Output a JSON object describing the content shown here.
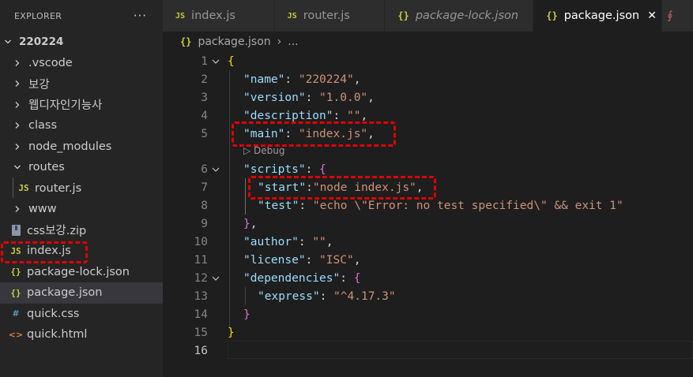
{
  "explorer": {
    "title": "EXPLORER",
    "more": "···",
    "root": "220224",
    "items": [
      {
        "label": ".vscode",
        "type": "folder"
      },
      {
        "label": "보강",
        "type": "folder"
      },
      {
        "label": "웹디자인기능사",
        "type": "folder"
      },
      {
        "label": "class",
        "type": "folder"
      },
      {
        "label": "node_modules",
        "type": "folder"
      },
      {
        "label": "routes",
        "type": "folder-open"
      },
      {
        "label": "router.js",
        "type": "js"
      },
      {
        "label": "www",
        "type": "folder"
      },
      {
        "label": "css보강.zip",
        "type": "zip"
      },
      {
        "label": "index.js",
        "type": "js"
      },
      {
        "label": "package-lock.json",
        "type": "json"
      },
      {
        "label": "package.json",
        "type": "json"
      },
      {
        "label": "quick.css",
        "type": "css"
      },
      {
        "label": "quick.html",
        "type": "html"
      }
    ]
  },
  "tabs": [
    {
      "label": "index.js",
      "icon": "JS"
    },
    {
      "label": "router.js",
      "icon": "JS"
    },
    {
      "label": "package-lock.json",
      "icon": "{}"
    },
    {
      "label": "package.json",
      "icon": "{}",
      "close": "✕"
    }
  ],
  "breadcrumb": {
    "file": "package.json",
    "rest": "..."
  },
  "codelens": "▷ Debug",
  "editor": {
    "line_numbers": [
      "1",
      "2",
      "3",
      "4",
      "5",
      "6",
      "7",
      "8",
      "9",
      "10",
      "11",
      "12",
      "13",
      "14",
      "15",
      "16"
    ],
    "lines": {
      "l1_open": "{",
      "l2_key": "\"name\"",
      "l2_val": "\"220224\"",
      "l3_key": "\"version\"",
      "l3_val": "\"1.0.0\"",
      "l4_key": "\"description\"",
      "l4_val": "\"\"",
      "l5_key": "\"main\"",
      "l5_val": "\"index.js\"",
      "l6_key": "\"scripts\"",
      "l6_open": "{",
      "l7_key": "\"start\"",
      "l7_val": "\"node index.js\"",
      "l8_key": "\"test\"",
      "l8_val": "\"echo \\\"Error: no test specified\\\" && exit 1\"",
      "l9_close": "}",
      "l10_key": "\"author\"",
      "l10_val": "\"\"",
      "l11_key": "\"license\"",
      "l11_val": "\"ISC\"",
      "l12_key": "\"dependencies\"",
      "l12_open": "{",
      "l13_key": "\"express\"",
      "l13_val": "\"^4.17.3\"",
      "l14_close": "}",
      "l15_close": "}"
    },
    "punct": {
      "colon": ": ",
      "colon_tight": ":",
      "comma": ","
    }
  },
  "colors": {
    "highlight_box": "#e00000",
    "json_key": "#9cdcfe",
    "json_string": "#ce9178",
    "bracket_level1": "#ffd700",
    "bracket_level2": "#da70d6",
    "js_icon": "#cbcb41"
  }
}
